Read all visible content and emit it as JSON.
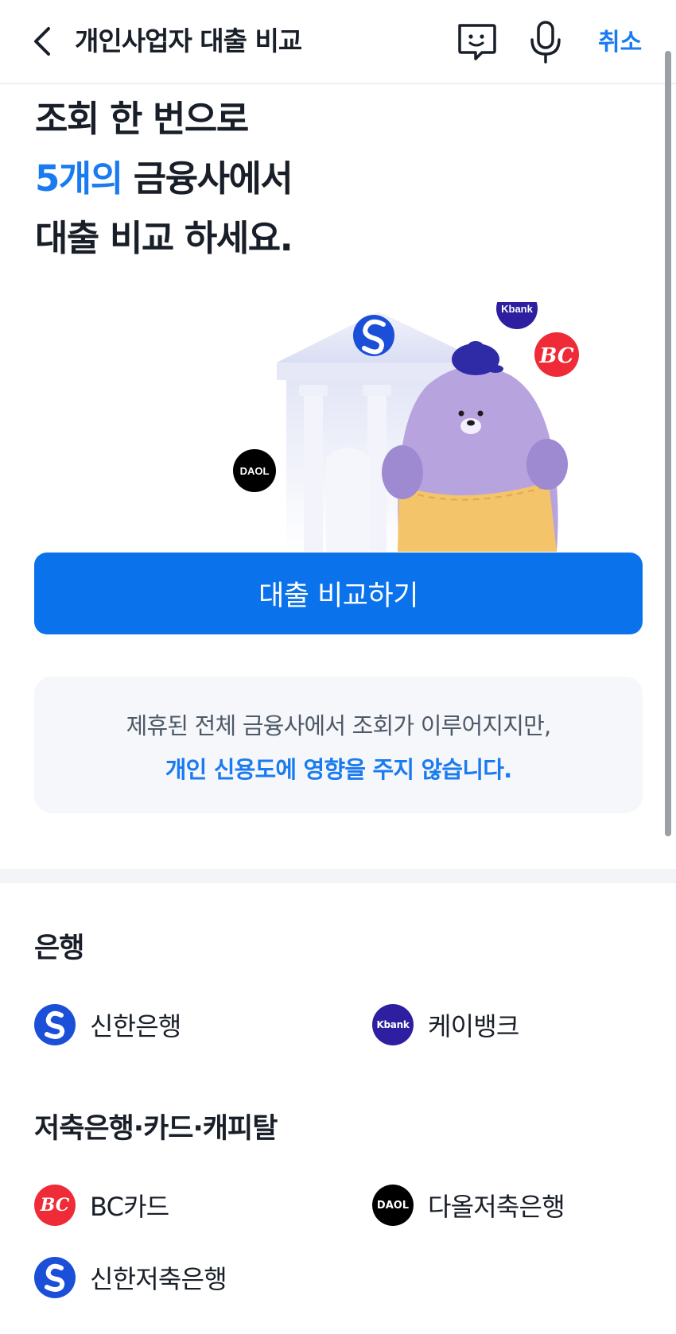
{
  "header": {
    "title": "개인사업자 대출 비교",
    "cancel_label": "취소",
    "icons": [
      "back-chevron-icon",
      "chat-face-icon",
      "microphone-icon"
    ]
  },
  "hero": {
    "line1": "조회 한 번으로",
    "line2_accent": "5개의",
    "line2_rest": " 금융사에서",
    "line3": "대출 비교 하세요."
  },
  "illustration": {
    "kbank_badge": "Kbank",
    "bc_badge": "BC",
    "daol_badge": "DAOL"
  },
  "cta": {
    "label": "대출 비교하기"
  },
  "notice": {
    "line1": "제휴된 전체 금융사에서 조회가 이루어지지만,",
    "line2": "개인 신용도에 영향을 주지 않습니다."
  },
  "sections": {
    "banks_title": "은행",
    "others_title": "저축은행·카드·캐피탈"
  },
  "banks": [
    {
      "name": "신한은행",
      "logo_text": ""
    },
    {
      "name": "케이뱅크",
      "logo_text": "Kbank"
    }
  ],
  "others": [
    {
      "name": "BC카드",
      "logo_text": "BC"
    },
    {
      "name": "다올저축은행",
      "logo_text": "DAOL"
    },
    {
      "name": "신한저축은행",
      "logo_text": ""
    }
  ],
  "colors": {
    "accent": "#1a7bf0",
    "cta_background": "#0a72ea",
    "shinhan": "#1b4fd8",
    "kbank": "#2d1fa0",
    "bc": "#ee2b37",
    "daol": "#000000"
  }
}
